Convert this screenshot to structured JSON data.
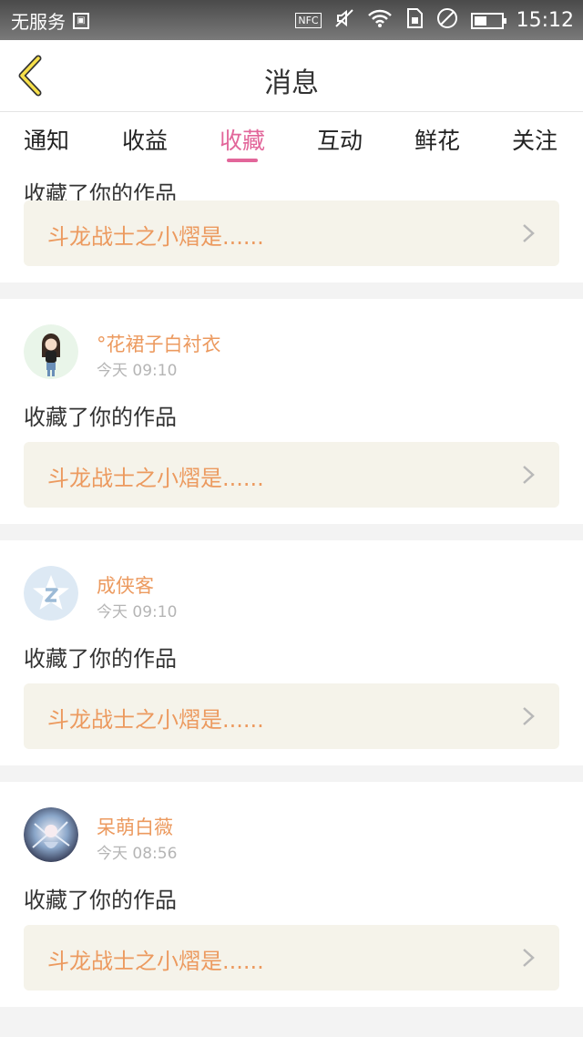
{
  "status_bar": {
    "carrier": "无服务",
    "nfc_label": "NFC",
    "time": "15:12",
    "battery_level": 0.45
  },
  "header": {
    "title": "消息"
  },
  "tabs": [
    {
      "label": "通知"
    },
    {
      "label": "收益"
    },
    {
      "label": "收藏",
      "active": true
    },
    {
      "label": "互动"
    },
    {
      "label": "鲜花"
    },
    {
      "label": "关注"
    }
  ],
  "colors": {
    "accent": "#e2669a",
    "name_orange": "#ec9a5f",
    "work_bg": "#f5f3ea"
  },
  "feed": {
    "partial_item": {
      "action": "收藏了你的作品",
      "work_title": "斗龙战士之小熠是......"
    },
    "items": [
      {
        "user": "°花裙子白衬衣",
        "time": "今天 09:10",
        "action": "收藏了你的作品",
        "work_title": "斗龙战士之小熠是......",
        "avatar_icon": "girl-avatar-icon"
      },
      {
        "user": "成侠客",
        "time": "今天 09:10",
        "action": "收藏了你的作品",
        "work_title": "斗龙战士之小熠是......",
        "avatar_icon": "qzone-star-avatar-icon"
      },
      {
        "user": "呆萌白薇",
        "time": "今天 08:56",
        "action": "收藏了你的作品",
        "work_title": "斗龙战士之小熠是......",
        "avatar_icon": "anime-avatar-icon"
      }
    ]
  }
}
